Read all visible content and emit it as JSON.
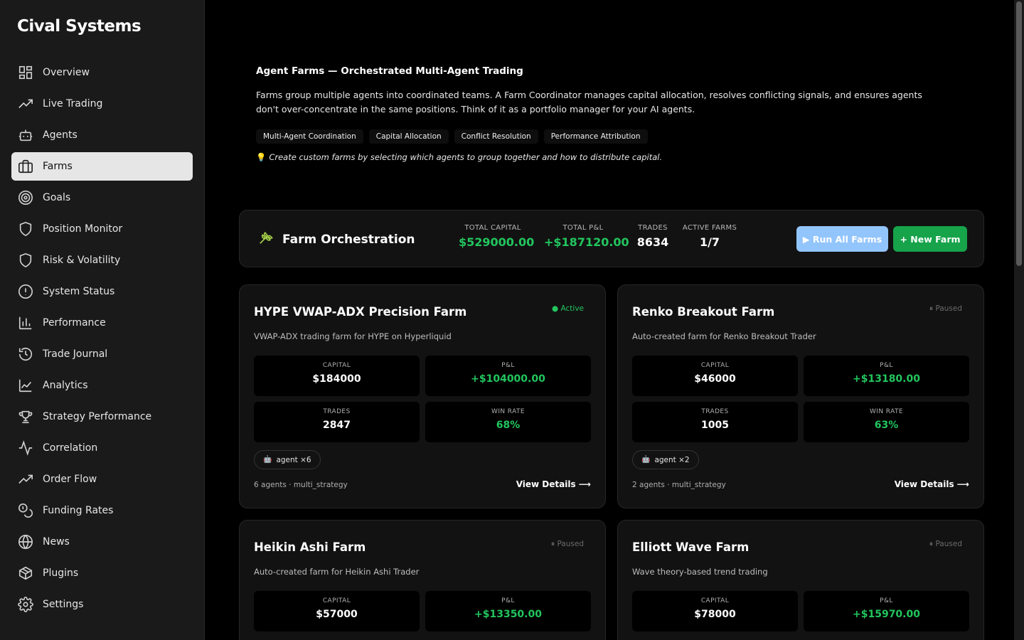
{
  "brand": "Cival Systems",
  "nav": [
    {
      "label": "Overview",
      "icon": "grid-icon"
    },
    {
      "label": "Live Trading",
      "icon": "trending-up-icon"
    },
    {
      "label": "Agents",
      "icon": "bot-icon"
    },
    {
      "label": "Farms",
      "icon": "briefcase-icon",
      "active": true
    },
    {
      "label": "Goals",
      "icon": "target-icon"
    },
    {
      "label": "Position Monitor",
      "icon": "shield-icon"
    },
    {
      "label": "Risk & Volatility",
      "icon": "shield-icon"
    },
    {
      "label": "System Status",
      "icon": "alert-circle-icon"
    },
    {
      "label": "Performance",
      "icon": "bar-chart-icon"
    },
    {
      "label": "Trade Journal",
      "icon": "history-icon"
    },
    {
      "label": "Analytics",
      "icon": "line-chart-icon"
    },
    {
      "label": "Strategy Performance",
      "icon": "trophy-icon"
    },
    {
      "label": "Correlation",
      "icon": "activity-icon"
    },
    {
      "label": "Order Flow",
      "icon": "trending-up-icon"
    },
    {
      "label": "Funding Rates",
      "icon": "coins-icon"
    },
    {
      "label": "News",
      "icon": "globe-icon"
    },
    {
      "label": "Plugins",
      "icon": "package-icon"
    },
    {
      "label": "Settings",
      "icon": "gear-icon"
    }
  ],
  "intro": {
    "title": "Agent Farms — Orchestrated Multi-Agent Trading",
    "description": "Farms group multiple agents into coordinated teams. A Farm Coordinator manages capital allocation, resolves conflicting signals, and ensures agents don't over-concentrate in the same positions. Think of it as a portfolio manager for your AI agents.",
    "tags": [
      "Multi-Agent Coordination",
      "Capital Allocation",
      "Conflict Resolution",
      "Performance Attribution"
    ],
    "tip": "Create custom farms by selecting which agents to group together and how to distribute capital."
  },
  "orchestration": {
    "title": "Farm Orchestration",
    "stats": {
      "total_capital": {
        "label": "TOTAL CAPITAL",
        "value": "$529000.00"
      },
      "total_pnl": {
        "label": "TOTAL P&L",
        "value": "+$187120.00"
      },
      "trades": {
        "label": "TRADES",
        "value": "8634"
      },
      "active_farms": {
        "label": "ACTIVE FARMS",
        "value": "1/7"
      }
    },
    "run_all_label": "▶ Run All Farms",
    "new_farm_label": "+ New Farm"
  },
  "colors": {
    "accent_green": "#22c55e",
    "run_button": "#93c5fd",
    "new_button": "#16a34a"
  },
  "labels": {
    "capital": "CAPITAL",
    "pnl": "P&L",
    "trades": "TRADES",
    "win_rate": "WIN RATE",
    "view_details": "View Details ⟶"
  },
  "farms": [
    {
      "name": "HYPE VWAP-ADX Precision Farm",
      "status": "● Active",
      "description": "VWAP-ADX trading farm for HYPE on Hyperliquid",
      "capital": "$184000",
      "pnl": "+$104000.00",
      "trades": "2847",
      "win_rate": "68%",
      "agents_chip": "agent ×6",
      "footer": "6 agents · multi_strategy"
    },
    {
      "name": "Renko Breakout Farm",
      "status": "⏸ Paused",
      "description": "Auto-created farm for Renko Breakout Trader",
      "capital": "$46000",
      "pnl": "+$13180.00",
      "trades": "1005",
      "win_rate": "63%",
      "agents_chip": "agent ×2",
      "footer": "2 agents · multi_strategy"
    },
    {
      "name": "Heikin Ashi Farm",
      "status": "⏸ Paused",
      "description": "Auto-created farm for Heikin Ashi Trader",
      "capital": "$57000",
      "pnl": "+$13350.00"
    },
    {
      "name": "Elliott Wave Farm",
      "status": "⏸ Paused",
      "description": "Wave theory-based trend trading",
      "capital": "$78000",
      "pnl": "+$15970.00"
    }
  ]
}
